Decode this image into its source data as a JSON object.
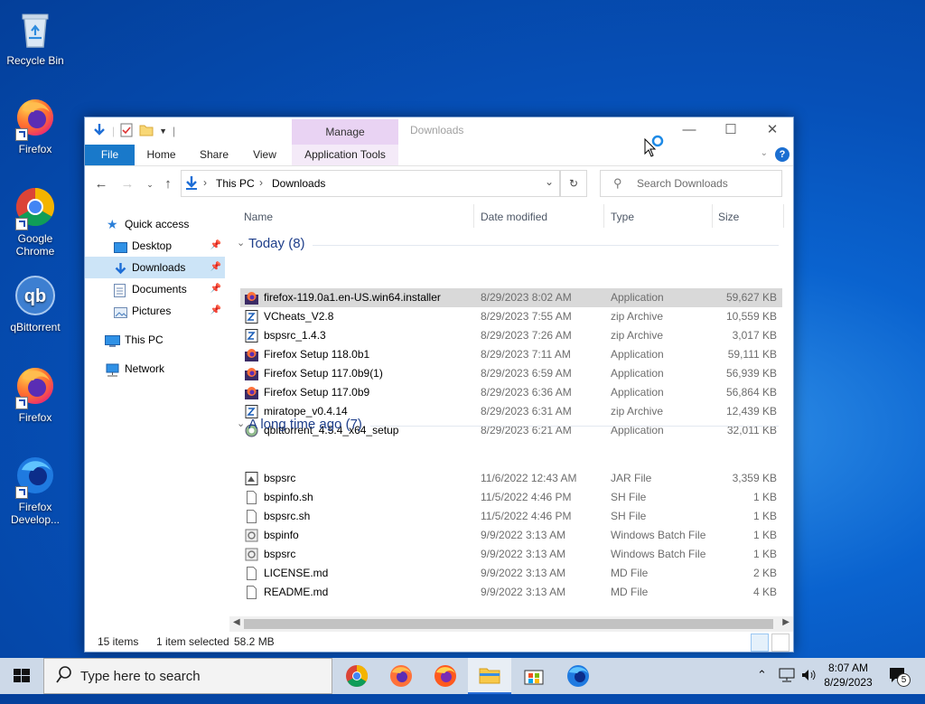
{
  "desktop": {
    "icons": [
      {
        "label": "Recycle Bin"
      },
      {
        "label": "Firefox"
      },
      {
        "label": "Google Chrome"
      },
      {
        "label": "qBittorrent"
      },
      {
        "label": "Firefox"
      },
      {
        "label": "Firefox Develop..."
      }
    ]
  },
  "window": {
    "title": "Downloads",
    "ribbon": {
      "context_group": "Manage",
      "context_tab": "Application Tools",
      "tabs": [
        "File",
        "Home",
        "Share",
        "View"
      ]
    },
    "address": {
      "crumbs": [
        "This PC",
        "Downloads"
      ]
    },
    "search": {
      "placeholder": "Search Downloads"
    },
    "nav_pane": {
      "quick_access": "Quick access",
      "items": [
        "Desktop",
        "Downloads",
        "Documents",
        "Pictures"
      ],
      "this_pc": "This PC",
      "network": "Network"
    },
    "columns": {
      "name": "Name",
      "date": "Date modified",
      "type": "Type",
      "size": "Size"
    },
    "groups": [
      {
        "label": "Today (8)",
        "files": [
          {
            "name": "firefox-119.0a1.en-US.win64.installer",
            "date": "8/29/2023 8:02 AM",
            "type": "Application",
            "size": "59,627 KB",
            "icon": "firefox-app-icon"
          },
          {
            "name": "VCheats_V2.8",
            "date": "8/29/2023 7:55 AM",
            "type": "zip Archive",
            "size": "10,559 KB",
            "icon": "zip-icon"
          },
          {
            "name": "bspsrc_1.4.3",
            "date": "8/29/2023 7:26 AM",
            "type": "zip Archive",
            "size": "3,017 KB",
            "icon": "zip-icon"
          },
          {
            "name": "Firefox Setup 118.0b1",
            "date": "8/29/2023 7:11 AM",
            "type": "Application",
            "size": "59,111 KB",
            "icon": "firefox-app-icon"
          },
          {
            "name": "Firefox Setup 117.0b9(1)",
            "date": "8/29/2023 6:59 AM",
            "type": "Application",
            "size": "56,939 KB",
            "icon": "firefox-app-icon"
          },
          {
            "name": "Firefox Setup 117.0b9",
            "date": "8/29/2023 6:36 AM",
            "type": "Application",
            "size": "56,864 KB",
            "icon": "firefox-app-icon"
          },
          {
            "name": "miratope_v0.4.14",
            "date": "8/29/2023 6:31 AM",
            "type": "zip Archive",
            "size": "12,439 KB",
            "icon": "zip-icon"
          },
          {
            "name": "qbittorrent_4.5.4_x64_setup",
            "date": "8/29/2023 6:21 AM",
            "type": "Application",
            "size": "32,011 KB",
            "icon": "setup-app-icon"
          }
        ]
      },
      {
        "label": "A long time ago (7)",
        "files": [
          {
            "name": "bspsrc",
            "date": "11/6/2022 12:43 AM",
            "type": "JAR File",
            "size": "3,359 KB",
            "icon": "jar-icon"
          },
          {
            "name": "bspinfo.sh",
            "date": "11/5/2022 4:46 PM",
            "type": "SH File",
            "size": "1 KB",
            "icon": "file-icon"
          },
          {
            "name": "bspsrc.sh",
            "date": "11/5/2022 4:46 PM",
            "type": "SH File",
            "size": "1 KB",
            "icon": "file-icon"
          },
          {
            "name": "bspinfo",
            "date": "9/9/2022 3:13 AM",
            "type": "Windows Batch File",
            "size": "1 KB",
            "icon": "batch-icon"
          },
          {
            "name": "bspsrc",
            "date": "9/9/2022 3:13 AM",
            "type": "Windows Batch File",
            "size": "1 KB",
            "icon": "batch-icon"
          },
          {
            "name": "LICENSE.md",
            "date": "9/9/2022 3:13 AM",
            "type": "MD File",
            "size": "2 KB",
            "icon": "file-icon"
          },
          {
            "name": "README.md",
            "date": "9/9/2022 3:13 AM",
            "type": "MD File",
            "size": "4 KB",
            "icon": "file-icon"
          }
        ]
      }
    ],
    "status": {
      "items": "15 items",
      "selected": "1 item selected",
      "size": "58.2 MB"
    }
  },
  "taskbar": {
    "search_placeholder": "Type here to search",
    "time": "8:07 AM",
    "date": "8/29/2023",
    "notification_count": "5"
  },
  "colors": {
    "accent": "#1979ca",
    "selection": "#cce4f7",
    "manage": "#e9d3f3"
  }
}
